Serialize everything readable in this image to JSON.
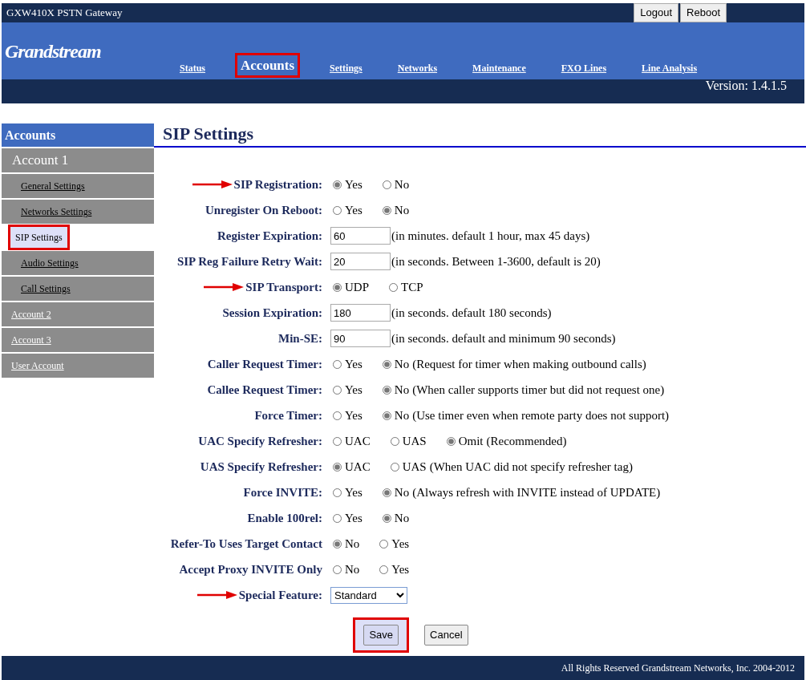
{
  "window": {
    "title": "GXW410X PSTN Gateway"
  },
  "top_buttons": [
    "Logout",
    "Reboot"
  ],
  "logo": "Grandstream",
  "nav": [
    {
      "label": "Status",
      "selected": false,
      "highlighted": false
    },
    {
      "label": "Accounts",
      "selected": true,
      "highlighted": true
    },
    {
      "label": "Settings",
      "selected": false,
      "highlighted": false
    },
    {
      "label": "Networks",
      "selected": false,
      "highlighted": false
    },
    {
      "label": "Maintenance",
      "selected": false,
      "highlighted": false
    },
    {
      "label": "FXO Lines",
      "selected": false,
      "highlighted": false
    },
    {
      "label": "Line Analysis",
      "selected": false,
      "highlighted": false
    }
  ],
  "version": "Version: 1.4.1.5",
  "sidebar": {
    "title": "Accounts",
    "items": [
      {
        "label": "Account 1",
        "selected": false,
        "highlighted": false,
        "children": [
          {
            "label": "General Settings",
            "selected": false,
            "highlighted": false
          },
          {
            "label": "Networks Settings",
            "selected": false,
            "highlighted": false
          },
          {
            "label": "SIP Settings",
            "selected": true,
            "highlighted": true
          },
          {
            "label": "Audio Settings",
            "selected": false,
            "highlighted": false
          },
          {
            "label": "Call Settings",
            "selected": false,
            "highlighted": false
          }
        ]
      },
      {
        "label": "Account 2",
        "selected": false,
        "highlighted": false
      },
      {
        "label": "Account 3",
        "selected": false,
        "highlighted": false
      },
      {
        "label": "User Account",
        "selected": false,
        "highlighted": false
      }
    ]
  },
  "page_title": "SIP Settings",
  "rows": [
    {
      "kind": "radio",
      "label": "SIP Registration:",
      "arrow": true,
      "options": [
        {
          "label": "Yes",
          "selected": true
        },
        {
          "label": "No",
          "selected": false
        }
      ]
    },
    {
      "kind": "radio",
      "label": "Unregister On Reboot:",
      "arrow": false,
      "options": [
        {
          "label": "Yes",
          "selected": false
        },
        {
          "label": "No",
          "selected": true
        }
      ]
    },
    {
      "kind": "text",
      "label": "Register Expiration:",
      "arrow": false,
      "value": "60",
      "note": "(in minutes. default 1 hour, max 45 days)"
    },
    {
      "kind": "text",
      "label": "SIP Reg Failure Retry Wait:",
      "arrow": false,
      "value": "20",
      "note": "(in seconds. Between 1-3600, default is 20)"
    },
    {
      "kind": "radio",
      "label": "SIP Transport:",
      "arrow": true,
      "options": [
        {
          "label": "UDP",
          "selected": true
        },
        {
          "label": "TCP",
          "selected": false
        }
      ]
    },
    {
      "kind": "text",
      "label": "Session Expiration:",
      "arrow": false,
      "value": "180",
      "note": "(in seconds. default 180 seconds)"
    },
    {
      "kind": "text",
      "label": "Min-SE:",
      "arrow": false,
      "value": "90",
      "note": "(in seconds. default and minimum 90 seconds)"
    },
    {
      "kind": "radio",
      "label": "Caller Request Timer:",
      "arrow": false,
      "options": [
        {
          "label": "Yes",
          "selected": false
        },
        {
          "label": "No",
          "selected": true
        }
      ],
      "note": "(Request for timer when making outbound calls)"
    },
    {
      "kind": "radio",
      "label": "Callee Request Timer:",
      "arrow": false,
      "options": [
        {
          "label": "Yes",
          "selected": false
        },
        {
          "label": "No",
          "selected": true
        }
      ],
      "note": "(When caller supports timer but did not request one)"
    },
    {
      "kind": "radio",
      "label": "Force Timer:",
      "arrow": false,
      "options": [
        {
          "label": "Yes",
          "selected": false
        },
        {
          "label": "No",
          "selected": true
        }
      ],
      "note": "(Use timer even when remote party does not support)"
    },
    {
      "kind": "radio",
      "label": "UAC Specify Refresher:",
      "arrow": false,
      "options": [
        {
          "label": "UAC",
          "selected": false
        },
        {
          "label": "UAS",
          "selected": false
        },
        {
          "label": "Omit",
          "selected": true
        }
      ],
      "note": "(Recommended)"
    },
    {
      "kind": "radio",
      "label": "UAS Specify Refresher:",
      "arrow": false,
      "options": [
        {
          "label": "UAC",
          "selected": true
        },
        {
          "label": "UAS",
          "selected": false
        }
      ],
      "note": "(When UAC did not specify refresher tag)"
    },
    {
      "kind": "radio",
      "label": "Force INVITE:",
      "arrow": false,
      "options": [
        {
          "label": "Yes",
          "selected": false
        },
        {
          "label": "No",
          "selected": true
        }
      ],
      "note": "(Always refresh with INVITE instead of UPDATE)"
    },
    {
      "kind": "radio",
      "label": "Enable 100rel:",
      "arrow": false,
      "options": [
        {
          "label": "Yes",
          "selected": false
        },
        {
          "label": "No",
          "selected": true
        }
      ]
    },
    {
      "kind": "radio",
      "label": "Refer-To Uses Target Contact",
      "arrow": false,
      "options": [
        {
          "label": "No",
          "selected": true
        },
        {
          "label": "Yes",
          "selected": false
        }
      ]
    },
    {
      "kind": "radio",
      "label": "Accept Proxy INVITE Only",
      "arrow": false,
      "options": [
        {
          "label": "No",
          "selected": false
        },
        {
          "label": "Yes",
          "selected": false
        }
      ]
    },
    {
      "kind": "select",
      "label": "Special Feature:",
      "arrow": true,
      "value": "Standard"
    }
  ],
  "buttons": [
    {
      "label": "Save",
      "highlighted": true
    },
    {
      "label": "Cancel",
      "highlighted": false
    }
  ],
  "footer": "All Rights Reserved Grandstream Networks, Inc. 2004-2012"
}
